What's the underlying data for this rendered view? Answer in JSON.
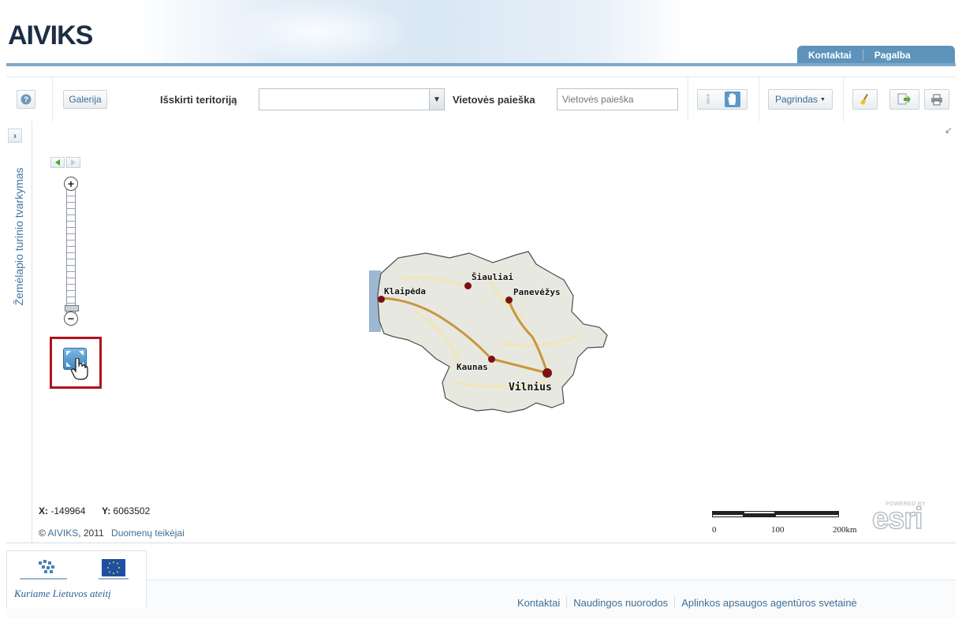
{
  "header": {
    "logo": "AIVIKS",
    "tabs": [
      "Kontaktai",
      "Pagalba"
    ]
  },
  "toolbar": {
    "help_icon": "help-icon",
    "gallery_label": "Galerija",
    "territory_label": "Išskirti teritoriją",
    "territory_value": "",
    "search_label": "Vietovės paieška",
    "search_placeholder": "Vietovės paieška",
    "basemap_label": "Pagrindas",
    "tool_icons": [
      "info-icon",
      "pan-hand-icon",
      "clear-brush-icon",
      "export-icon",
      "print-icon"
    ]
  },
  "sidebar": {
    "title": "Žemėlapio turinio tvarkymas",
    "toggle": "›"
  },
  "map": {
    "cities": [
      {
        "name": "Šiauliai"
      },
      {
        "name": "Klaipėda"
      },
      {
        "name": "Panevėžys"
      },
      {
        "name": "Kaunas"
      },
      {
        "name": "Vilnius"
      }
    ],
    "coords": {
      "x_label": "X:",
      "x_value": "-149964",
      "y_label": "Y:",
      "y_value": "6063502"
    },
    "copyright_prefix": "©",
    "copyright_link": "AIVIKS",
    "copyright_year": ", 2011",
    "data_providers": "Duomenų teikėjai",
    "scale": {
      "labels": [
        "0",
        "100",
        "200km"
      ]
    },
    "powered_by": "POWERED BY",
    "esri": "esri",
    "zoom_level_fraction": 0.95
  },
  "footer": {
    "slogan": "Kuriame Lietuvos ateitį",
    "links": [
      "Kontaktai",
      "Naudingos nuorodos",
      "Aplinkos apsaugos agentūros svetainė"
    ]
  },
  "colors": {
    "accent": "#5e93bb",
    "link": "#3f6f96",
    "city_dot": "#7a1212",
    "highlight_box": "#b0121b",
    "logo": "#1c2e45"
  }
}
